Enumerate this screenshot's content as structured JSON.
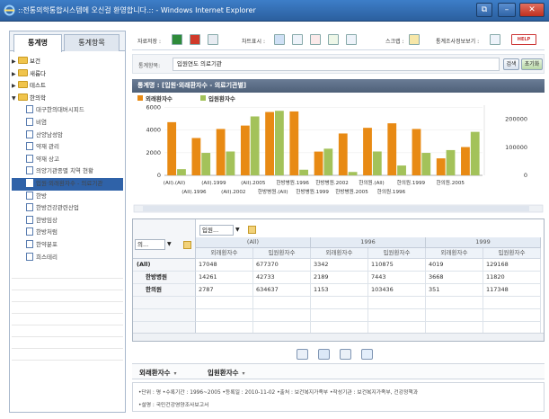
{
  "window": {
    "title": "::전통의학통합시스템에 오신걸 환영합니다.:: - Windows Internet Explorer"
  },
  "left_tabs": [
    "통계명",
    "통계항목"
  ],
  "tree": [
    {
      "label": "보건",
      "type": "folder",
      "expanded": false
    },
    {
      "label": "새롭다",
      "type": "folder",
      "expanded": false
    },
    {
      "label": "테스트",
      "type": "folder",
      "expanded": false
    },
    {
      "label": "한의학",
      "type": "folder",
      "expanded": true
    },
    {
      "label": "대구한의대버시피드",
      "type": "doc"
    },
    {
      "label": "비염",
      "type": "doc"
    },
    {
      "label": "산양남성암",
      "type": "doc"
    },
    {
      "label": "약재 관리",
      "type": "doc"
    },
    {
      "label": "약재 상고",
      "type": "doc"
    },
    {
      "label": "의양기관종별 치역 현황",
      "type": "doc"
    },
    {
      "label": "입원·외래환자수 - 의료기관",
      "type": "doc",
      "selected": true
    },
    {
      "label": "한방",
      "type": "doc"
    },
    {
      "label": "한방건강관련산업",
      "type": "doc"
    },
    {
      "label": "한방임상",
      "type": "doc"
    },
    {
      "label": "한방처럼",
      "type": "doc"
    },
    {
      "label": "한약분포",
      "type": "doc"
    },
    {
      "label": "희스테리",
      "type": "doc"
    }
  ],
  "toolbar": {
    "save_label": "자료저장 :",
    "chart_label": "차트표시 :",
    "script_label": "스크랩 :",
    "stat_view_label": "통계조사정보보기 :",
    "help_label": "HELP"
  },
  "search": {
    "label": "통계항목:",
    "value": "입원연도 의료기관",
    "search_button": "검색",
    "reset_button": "초기화"
  },
  "chart_header": "통계명 : [입원·외래환자수 - 의료기관별]",
  "chart_data": {
    "type": "bar",
    "series": [
      {
        "name": "외래환자수",
        "color": "#e88a14",
        "axis": "left",
        "values": [
          4700,
          3300,
          4100,
          4400,
          5600,
          5650,
          2100,
          3700,
          4200,
          4600,
          4100,
          1500,
          2500
        ]
      },
      {
        "name": "입원환자수",
        "color": "#a3c25a",
        "axis": "right",
        "values": [
          22000,
          80000,
          85000,
          210000,
          230000,
          20000,
          95000,
          12000,
          85000,
          35000,
          80000,
          90000,
          155000
        ]
      }
    ],
    "categories": [
      "(All).(All)",
      "(All).1996",
      "(All).1999",
      "(All).2002",
      "(All).2005",
      "한방병원.(All)",
      "한방병원.1996",
      "한방병원.1999",
      "한방병원.2002",
      "한방병원.2005",
      "한의원.(All)",
      "한의원.1996",
      "한의원.1999"
    ],
    "xlabels_row1": [
      "(All).(All)",
      "(All).1999",
      "(All).2005",
      "한방병원.1996",
      "한방병원.2002",
      "한의원.(All)",
      "한의원.1999",
      "한의원.2005"
    ],
    "xlabels_row2": [
      "(All).1996",
      "(All).2002",
      "한방병원.(All)",
      "한방병원.1999",
      "한방병원.2005",
      "한의원.1996"
    ],
    "yticks_left": [
      "0",
      "2000",
      "4000",
      "6000"
    ],
    "ylim_left": [
      0,
      6200
    ],
    "yticks_right": [
      "0",
      "100000",
      "200000"
    ],
    "ylim_right": [
      0,
      250000
    ],
    "legend_position": "top-left"
  },
  "grid": {
    "field_selector": "입원...",
    "row_selector": "의...",
    "col_years": [
      "(All)",
      "1996",
      "1999"
    ],
    "measures": [
      "외래환자수",
      "입원환자수"
    ],
    "rows": [
      {
        "label": "(All)",
        "values": [
          "17048",
          "677370",
          "3342",
          "110875",
          "4019",
          "129168"
        ]
      },
      {
        "label": "한방병원",
        "values": [
          "14261",
          "42733",
          "2189",
          "7443",
          "3668",
          "11820"
        ]
      },
      {
        "label": "한의원",
        "values": [
          "2787",
          "634637",
          "1153",
          "103436",
          "351",
          "117348"
        ]
      }
    ]
  },
  "measure_selectors": [
    "외래환자수",
    "입원환자수"
  ],
  "notes": {
    "line1": "•단위 : 명  •수록기간 : 1996~2005  •등록일 : 2010-11-02  •출처 : 보건복지가족부  •작성기관 : 보건복지가족부, 건강정책과",
    "line2": "•설명 : 국민건강영양조사보고서"
  }
}
